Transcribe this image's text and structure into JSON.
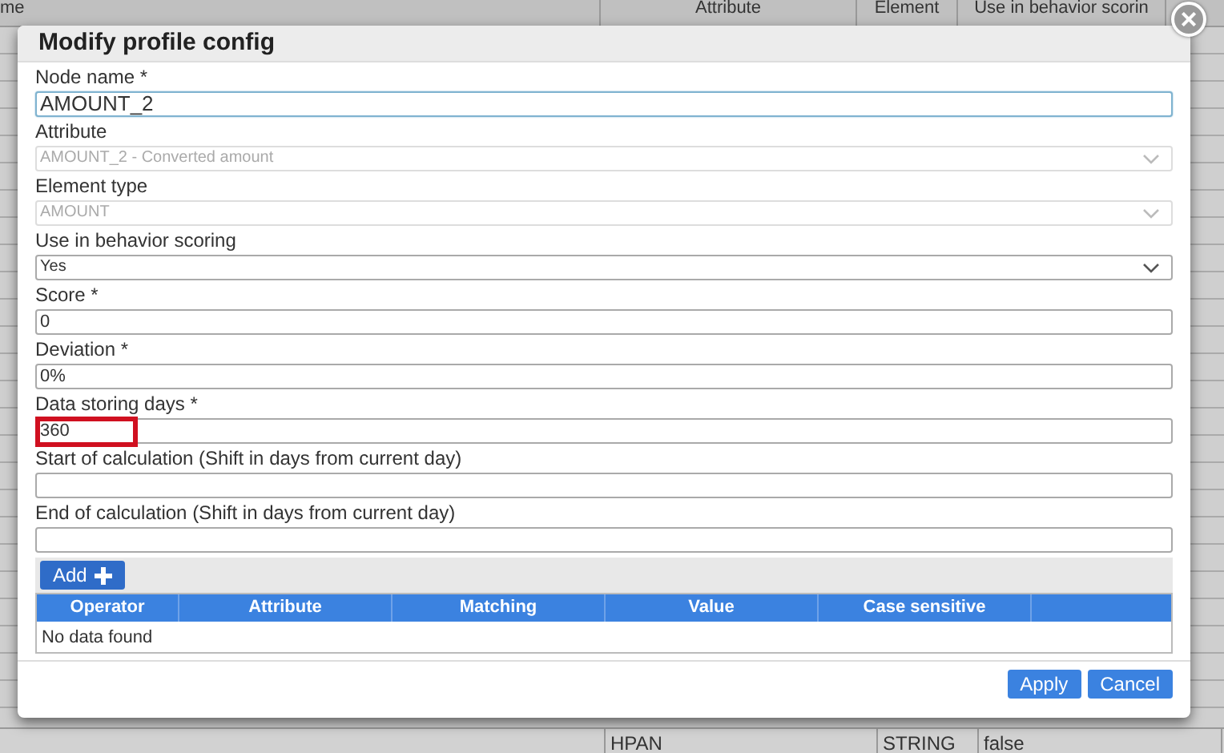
{
  "background_table": {
    "columns": [
      "me",
      "Attribute",
      "Element",
      "Use in behavior scorin"
    ],
    "bottom_row": [
      "HPAN",
      "STRING",
      "false"
    ]
  },
  "dialog": {
    "title": "Modify profile config",
    "close": "×",
    "fields": [
      {
        "label": "Node name *",
        "kind": "text",
        "value": "AMOUNT_2",
        "focused": true,
        "disabled": false,
        "highlighted": false
      },
      {
        "label": "Attribute",
        "kind": "select",
        "value": "AMOUNT_2 - Converted amount",
        "focused": false,
        "disabled": true,
        "highlighted": false
      },
      {
        "label": "Element type",
        "kind": "select",
        "value": "AMOUNT",
        "focused": false,
        "disabled": true,
        "highlighted": false
      },
      {
        "label": "Use in behavior scoring",
        "kind": "select",
        "value": "Yes",
        "focused": false,
        "disabled": false,
        "highlighted": false
      },
      {
        "label": "Score *",
        "kind": "text",
        "value": "0",
        "focused": false,
        "disabled": false,
        "highlighted": false
      },
      {
        "label": "Deviation *",
        "kind": "text",
        "value": "0%",
        "focused": false,
        "disabled": false,
        "highlighted": false
      },
      {
        "label": "Data storing days *",
        "kind": "text",
        "value": "360",
        "focused": false,
        "disabled": false,
        "highlighted": true
      },
      {
        "label": "Start of calculation (Shift in days from current day)",
        "kind": "text",
        "focused": false,
        "disabled": false,
        "highlighted": false
      },
      {
        "label": "End of calculation (Shift in days from current day)",
        "kind": "text",
        "focused": false,
        "disabled": false,
        "highlighted": false
      }
    ],
    "add_button": "Add",
    "conditions_table": {
      "columns": [
        "Operator",
        "Attribute",
        "Matching",
        "Value",
        "Case sensitive"
      ],
      "empty_text": "No data found"
    },
    "buttons": [
      "Apply",
      "Cancel"
    ]
  }
}
